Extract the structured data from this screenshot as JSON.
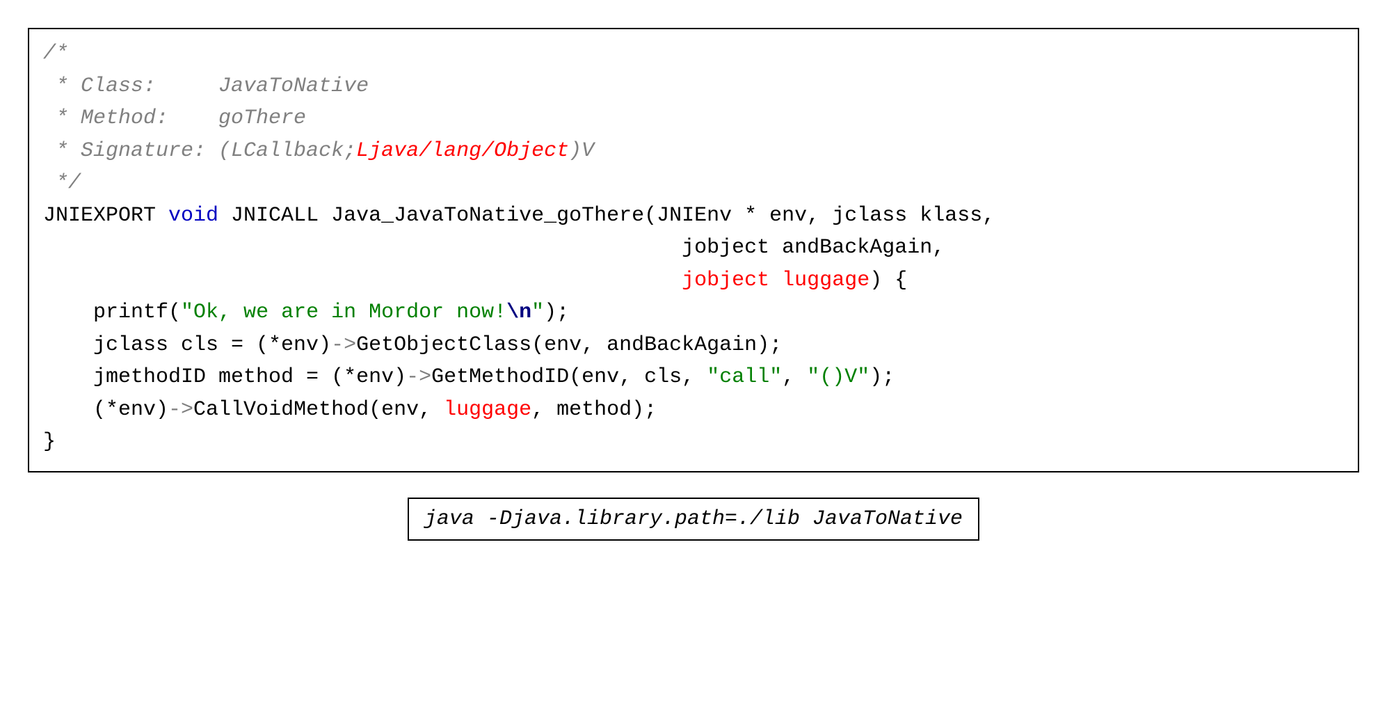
{
  "code": {
    "c1": "/*",
    "c2": " * Class:     JavaToNative",
    "c3": " * Method:    goThere",
    "c4a": " * Signature: (LCallback;",
    "c4b": "Ljava/lang/Object",
    "c4c": ")V",
    "c5": " */",
    "l6a": "JNIEXPORT ",
    "l6b": "void",
    "l6c": " JNICALL Java_JavaToNative_goThere(JNIEnv * env, jclass klass,",
    "l7": "                                                   jobject andBackAgain,",
    "l8pad": "                                                   ",
    "l8red": "jobject luggage",
    "l8end": ") {",
    "l9a": "    printf(",
    "l9b": "\"Ok, we are in Mordor now!",
    "l9c": "\\n",
    "l9d": "\"",
    "l9e": ");",
    "l10a": "    jclass cls = (*env)",
    "l10arrow": "->",
    "l10b": "GetObjectClass(env, andBackAgain);",
    "l11a": "    jmethodID method = (*env)",
    "l11arrow": "->",
    "l11b": "GetMethodID(env, cls, ",
    "l11c": "\"call\"",
    "l11d": ", ",
    "l11e": "\"()V\"",
    "l11f": ");",
    "l12a": "    (*env)",
    "l12arrow": "->",
    "l12b": "CallVoidMethod(env, ",
    "l12c": "luggage",
    "l12d": ", method);",
    "l13": "}"
  },
  "cmd": "java -Djava.library.path=./lib JavaToNative"
}
